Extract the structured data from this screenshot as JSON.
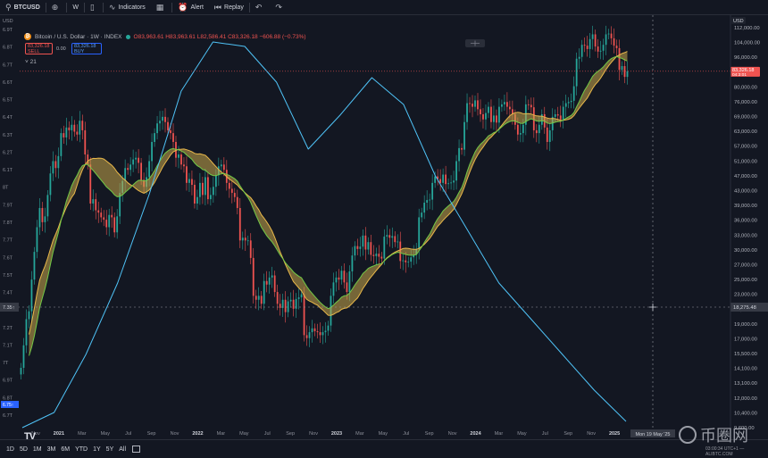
{
  "toolbar": {
    "symbol": "BTCUSD",
    "add_icon": "plus-circle-icon",
    "interval": "W",
    "indicators_label": "Indicators",
    "alert_label": "Alert",
    "replay_label": "Replay"
  },
  "legend": {
    "title": "Bitcoin / U.S. Dollar · 1W · INDEX",
    "ohlc": "O83,963.61 H83,963.61 L82,586.41 C83,326.18 −606.88 (−0.73%)",
    "sell_price": "83,326.18",
    "sell_label": "SELL",
    "spread": "0.00",
    "buy_price": "83,326.18",
    "buy_label": "BUY",
    "indicator": "21"
  },
  "colors": {
    "background": "#131722",
    "up": "#26a69a",
    "down": "#ef5350",
    "sma": "#e9b84a",
    "ema": "#72c947",
    "ribbon": "#c9a84a",
    "cycle": "#4fc3f7"
  },
  "bottom": {
    "ranges": [
      "1D",
      "5D",
      "1M",
      "3M",
      "6M",
      "YTD",
      "1Y",
      "5Y",
      "All"
    ],
    "brand": "TV",
    "watermark": "币圈网",
    "watermark_sub": "03:00:34 UTC+1 — ALIBTC.COM"
  },
  "chart_data": {
    "type": "line",
    "left_axis": {
      "labels": [
        "USD",
        "6.9T",
        "6.8T",
        "6.7T",
        "6.6T",
        "6.5T",
        "6.4T",
        "6.3T",
        "6.2T",
        "6.1T",
        "8T",
        "7.9T",
        "7.8T",
        "7.7T",
        "7.6T",
        "7.5T",
        "7.4T",
        "7.3T",
        "7.2T",
        "7.1T",
        "7T",
        "6.9T",
        "6.8T",
        "6.7T"
      ],
      "crosshair_label": "7.35↑",
      "current_label": "6.75↑"
    },
    "right_axis": {
      "currency": "USD",
      "ticks": [
        "112,000.00",
        "104,000.00",
        "96,000.00",
        "88,000.00",
        "80,000.00",
        "76,000.00",
        "69,000.00",
        "63,000.00",
        "57,000.00",
        "51,000.00",
        "47,000.00",
        "43,000.00",
        "39,000.00",
        "36,000.00",
        "33,000.00",
        "30,000.00",
        "27,000.00",
        "25,000.00",
        "23,000.00",
        "21,000.00",
        "19,000.00",
        "17,000.00",
        "15,500.00",
        "14,100.00",
        "13,100.00",
        "12,000.00",
        "10,400.00",
        "9,600.00"
      ],
      "price_label": "83,326.18",
      "countdown": "04:3:01",
      "crosshair_label": "18,275.48"
    },
    "x_ticks": [
      "Nov",
      "2021",
      "Mar",
      "May",
      "Jul",
      "Sep",
      "Nov",
      "2022",
      "Mar",
      "May",
      "Jul",
      "Sep",
      "Nov",
      "2023",
      "Mar",
      "May",
      "Jul",
      "Sep",
      "Nov",
      "2024",
      "Mar",
      "May",
      "Jul",
      "Sep",
      "Nov",
      "2025",
      "Mar"
    ],
    "crosshair_x_label": "Mon 19 May '25",
    "y_scale": "log",
    "series": [
      {
        "kind": "candles",
        "weekly_closes": [
          13500,
          15500,
          18200,
          19100,
          23200,
          27500,
          32000,
          36000,
          33000,
          34200,
          39000,
          44500,
          48000,
          46000,
          49500,
          57000,
          55500,
          59000,
          58000,
          60000,
          57500,
          56500,
          61500,
          58000,
          50000,
          47000,
          37000,
          38000,
          35500,
          35000,
          34000,
          33500,
          32000,
          34500,
          34000,
          31000,
          34200,
          39500,
          42500,
          46000,
          45500,
          47000,
          48500,
          49000,
          47500,
          42800,
          41000,
          43500,
          48000,
          54000,
          57000,
          60500,
          61500,
          63000,
          61000,
          58000,
          57000,
          54000,
          49000,
          50000,
          47000,
          46500,
          42000,
          43000,
          41500,
          37000,
          38500,
          42000,
          39000,
          43500,
          38000,
          39000,
          41000,
          44000,
          46500,
          47000,
          45500,
          42000,
          40500,
          39500,
          38500,
          36000,
          29500,
          30000,
          29500,
          29500,
          26500,
          21000,
          20500,
          21000,
          20000,
          23000,
          22500,
          23500,
          23800,
          21500,
          20000,
          19500,
          20500,
          19000,
          20300,
          20500,
          19400,
          20600,
          20800,
          21200,
          16500,
          16200,
          16800,
          17200,
          16900,
          16800,
          16500,
          16800,
          16950,
          17500,
          21000,
          22800,
          23500,
          23200,
          24500,
          22800,
          21500,
          24400,
          26900,
          28500,
          28000,
          28400,
          30400,
          27900,
          29200,
          27000,
          26800,
          27200,
          26700,
          26400,
          30200,
          30500,
          30000,
          30300,
          29200,
          29300,
          26000,
          26100,
          25800,
          25900,
          26600,
          27000,
          28000,
          34000,
          35000,
          37200,
          37800,
          37900,
          42000,
          43700,
          43000,
          42000,
          44200,
          41700,
          41900,
          42100,
          42600,
          48000,
          52000,
          51500,
          61000,
          68500,
          68300,
          67000,
          69700,
          66000,
          64000,
          62000,
          64500,
          67000,
          61000,
          63500,
          60800,
          67000,
          68000,
          69000,
          67000,
          66000,
          64000,
          60000,
          56500,
          57000,
          60000,
          68000,
          67800,
          66800,
          58000,
          57000,
          60000,
          64000,
          59000,
          54000,
          58000,
          63000,
          64000,
          63500,
          62000,
          67000,
          68500,
          69000,
          69500,
          76000,
          90000,
          91000,
          98000,
          97500,
          95500,
          101500,
          104500,
          97000,
          94000,
          94500,
          98000,
          104500,
          105000,
          102000,
          97500,
          96000,
          84000,
          86000,
          80500,
          83300
        ]
      },
      {
        "name": "",
        "kind": "sma",
        "color": "#e9b84a"
      },
      {
        "name": "",
        "kind": "ema",
        "color": "#72c947"
      },
      {
        "name": "",
        "kind": "overlay",
        "color": "#4fc3f7",
        "left_axis_values": [
          6.75,
          6.84,
          7.07,
          7.31,
          7.6,
          8.0,
          6.4,
          6.66,
          6.84,
          6.87,
          6.81,
          6.6,
          6.73,
          6.32,
          7.91,
          7.56,
          7.33,
          7.1,
          6.91,
          6.78
        ]
      }
    ]
  }
}
